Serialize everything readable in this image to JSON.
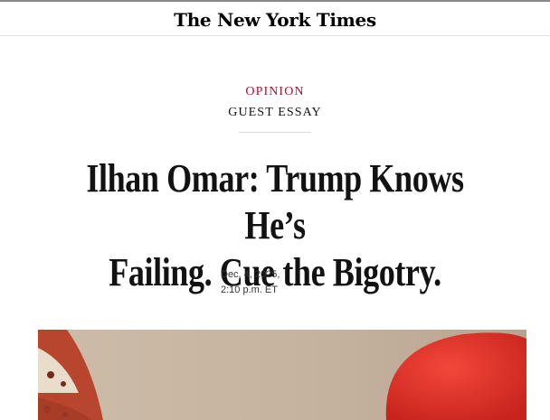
{
  "masthead": {
    "logo_text": "The New York Times"
  },
  "article": {
    "section": "OPINION",
    "label": "GUEST ESSAY",
    "headline_lines": [
      "Ilhan Omar: Trump Knows He’s",
      "Failing. Cue the Bigotry."
    ],
    "date": "Dec. 4, 2025,",
    "time": "2:10 p.m. ET"
  },
  "colors": {
    "kicker": "#b10f2e",
    "text": "#121212",
    "photo_red": "#e5332a"
  }
}
